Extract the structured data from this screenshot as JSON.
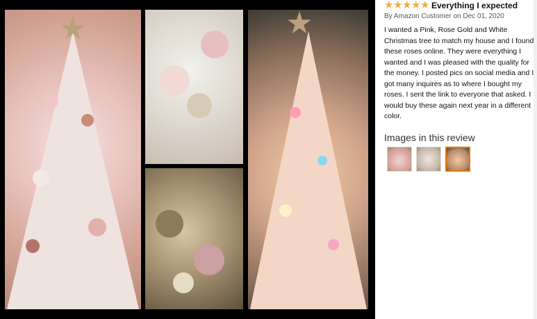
{
  "review": {
    "rating_stars": 5,
    "star_icon": "star-icon",
    "star_color": "#f3a847",
    "title": "Everything I expected",
    "byline": "By Amazon Customer on Dec 01, 2020",
    "body": "I wanted a Pink, Rose Gold and White Christmas tree to match my house and I found these roses online. They were everything I wanted and I was pleased with the quality for the money. I posted pics on social media and I got many inquires as to where I bought my roses. I sent the link to everyone that asked. I would buy these again next year in a different color.",
    "images_heading": "Images in this review",
    "thumbnails": [
      {
        "active": false
      },
      {
        "active": false
      },
      {
        "active": true
      }
    ],
    "active_thumb_border_color": "#e77600"
  }
}
